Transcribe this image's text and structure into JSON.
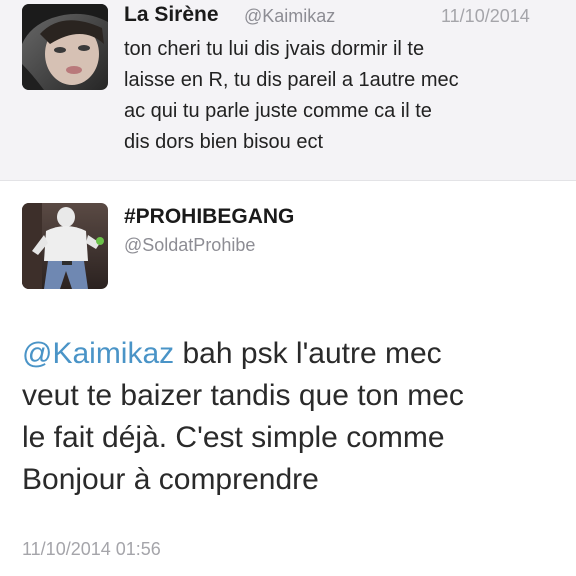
{
  "reply_tweet": {
    "display_name": "La Sirène",
    "handle": "@Kaimikaz",
    "date": "11/10/2014",
    "text_lines": [
      "ton cheri tu lui dis jvais dormir il te",
      "laisse en R, tu dis pareil a 1autre mec",
      "ac qui tu parle juste comme ca il te",
      "dis dors bien bisou ect"
    ]
  },
  "main_tweet": {
    "display_name": "#PROHIBEGANG",
    "handle": "@SoldatProhibe",
    "mention": "@Kaimikaz",
    "text_first_line_rest": " bah psk l'autre mec",
    "text_lines": [
      "veut te baizer tandis que ton mec",
      "le fait déjà. C'est simple comme",
      "Bonjour à comprendre"
    ],
    "timestamp": "11/10/2014 01:56"
  },
  "colors": {
    "mention": "#4a94c7",
    "reply_background": "#f4f3f6",
    "muted_text": "#8d8d94"
  }
}
